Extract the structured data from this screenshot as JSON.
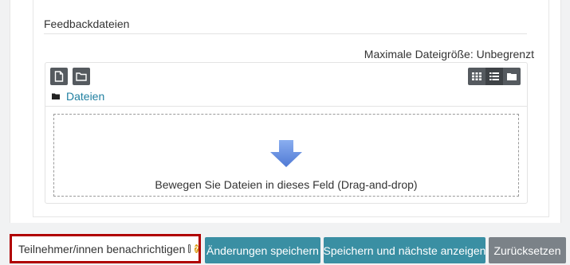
{
  "section": {
    "title": "Feedbackdateien",
    "max_size": "Maximale Dateigröße: Unbegrenzt"
  },
  "filemanager": {
    "toolbar": {
      "add_file_icon": "file-icon",
      "create_folder_icon": "folder-icon",
      "view_icons": [
        "grid-icon",
        "list-icon",
        "folder-tree-icon"
      ]
    },
    "breadcrumb": "Dateien",
    "dropzone_text": "Bewegen Sie Dateien in dieses Feld (Drag-and-drop)"
  },
  "footer": {
    "notify_label": "Teilnehmer/innen benachrichtigen",
    "save_label": "Änderungen speichern",
    "save_next_label": "Speichern und nächste anzeigen",
    "reset_label": "Zurücksetzen"
  },
  "colors": {
    "primary_button": "#3a8fa3",
    "secondary_button": "#7b8288",
    "link": "#1f7fa0",
    "highlight_border": "#b00000",
    "help_icon": "#d89a10"
  }
}
